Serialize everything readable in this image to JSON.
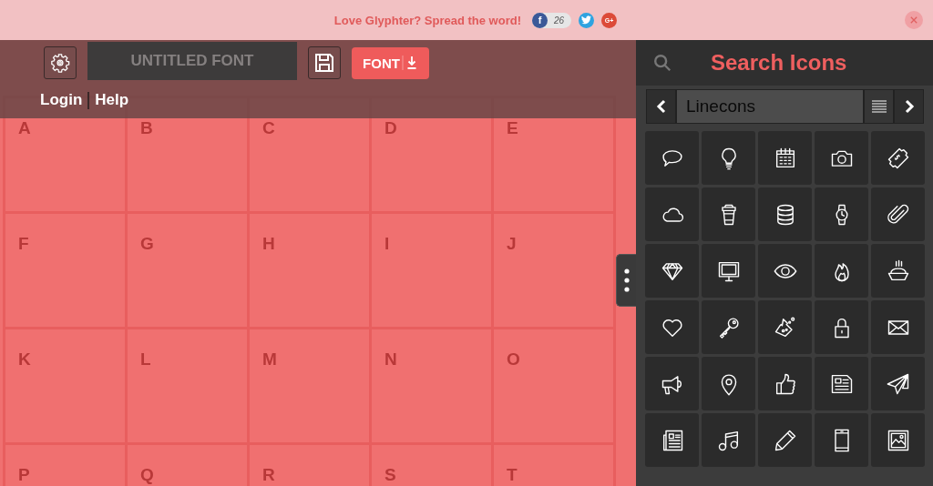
{
  "banner": {
    "text": "Love Glyphter? Spread the word!",
    "facebook_label": "f",
    "share_count": "26",
    "google_label": "G+"
  },
  "toolbar": {
    "font_name_placeholder": "UNTITLED FONT",
    "export_label": "FONT",
    "links": [
      "Login",
      "Help"
    ]
  },
  "glyph_cells": [
    "A",
    "B",
    "C",
    "D",
    "E",
    "F",
    "G",
    "H",
    "I",
    "J",
    "K",
    "L",
    "M",
    "N",
    "O",
    "P",
    "Q",
    "R",
    "S",
    "T"
  ],
  "icon_panel": {
    "title": "Search Icons",
    "icon_set": "Linecons"
  }
}
